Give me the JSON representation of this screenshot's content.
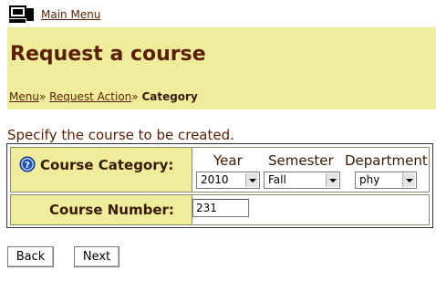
{
  "nav": {
    "main_menu": "Main Menu"
  },
  "header": {
    "title": "Request a course",
    "breadcrumb": {
      "items": [
        "Menu",
        "Request Action"
      ],
      "separator": "»",
      "current": "Category"
    }
  },
  "form": {
    "instructions": "Specify the course to be created.",
    "category": {
      "label": "Course Category:",
      "year": {
        "heading": "Year",
        "value": "2010"
      },
      "semester": {
        "heading": "Semester",
        "value": "Fall"
      },
      "department": {
        "heading": "Department",
        "value": "phy"
      }
    },
    "number": {
      "label": "Course Number:",
      "value": "231"
    }
  },
  "buttons": {
    "back": "Back",
    "next": "Next"
  },
  "colors": {
    "accent_bg": "#efec9c",
    "link": "#5a1f00"
  },
  "icons": {
    "home": "computer-icon",
    "help": "help-icon"
  }
}
